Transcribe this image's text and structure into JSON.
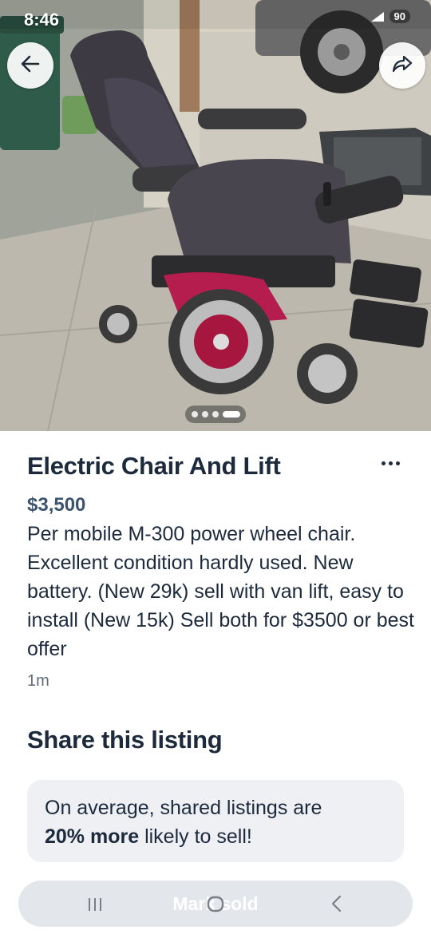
{
  "status_bar": {
    "time": "8:46",
    "battery": "90"
  },
  "hero": {
    "photo_alt": "Electric wheelchair with lift",
    "carousel_total": 4,
    "carousel_active": 4,
    "back_icon": "arrow-left-icon",
    "share_icon": "share-arrow-icon"
  },
  "listing": {
    "title": "Electric Chair And Lift",
    "price": "$3,500",
    "description": "Per mobile M-300 power wheel chair. Excellent condition hardly used. New battery. (New 29k) sell with van lift, easy to install (New 15k) Sell both for $3500 or best offer",
    "posted": "1m"
  },
  "share": {
    "heading": "Share this listing",
    "prefix": "On average, shared listings are",
    "highlight": "20% more",
    "suffix": "likely to sell!"
  },
  "bottom_bar": {
    "action_label": "Mark sold"
  },
  "colors": {
    "title": "#1c2a3c",
    "price": "#3d5470",
    "card_bg": "#eef0f4",
    "pill_bg": "#e3e6ea"
  }
}
